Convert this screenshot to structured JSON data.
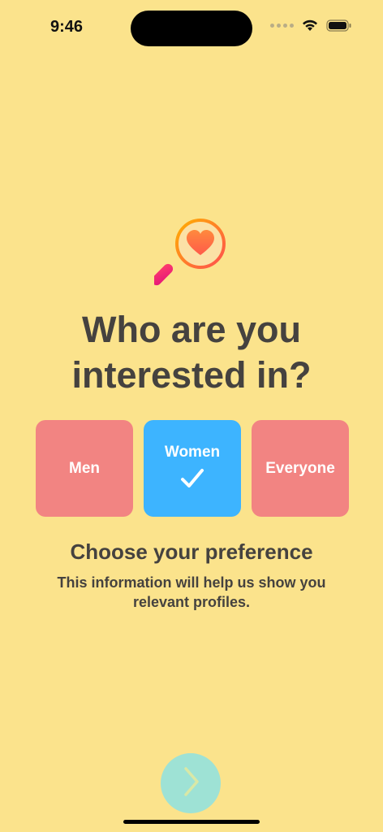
{
  "status_bar": {
    "time": "9:46"
  },
  "screen": {
    "icon": "magnifier-heart-icon",
    "title_line1": "Who are you",
    "title_line2": "interested in?",
    "options": [
      {
        "label": "Men",
        "selected": false,
        "color": "#F28482"
      },
      {
        "label": "Women",
        "selected": true,
        "color": "#3DB4FF"
      },
      {
        "label": "Everyone",
        "selected": false,
        "color": "#F28482"
      }
    ],
    "subtitle": "Choose your preference",
    "description": "This information will help us show you relevant profiles.",
    "next_button_icon": "chevron-right-icon"
  },
  "colors": {
    "background": "#FBE38C",
    "next_button": "#9EE2D5"
  }
}
